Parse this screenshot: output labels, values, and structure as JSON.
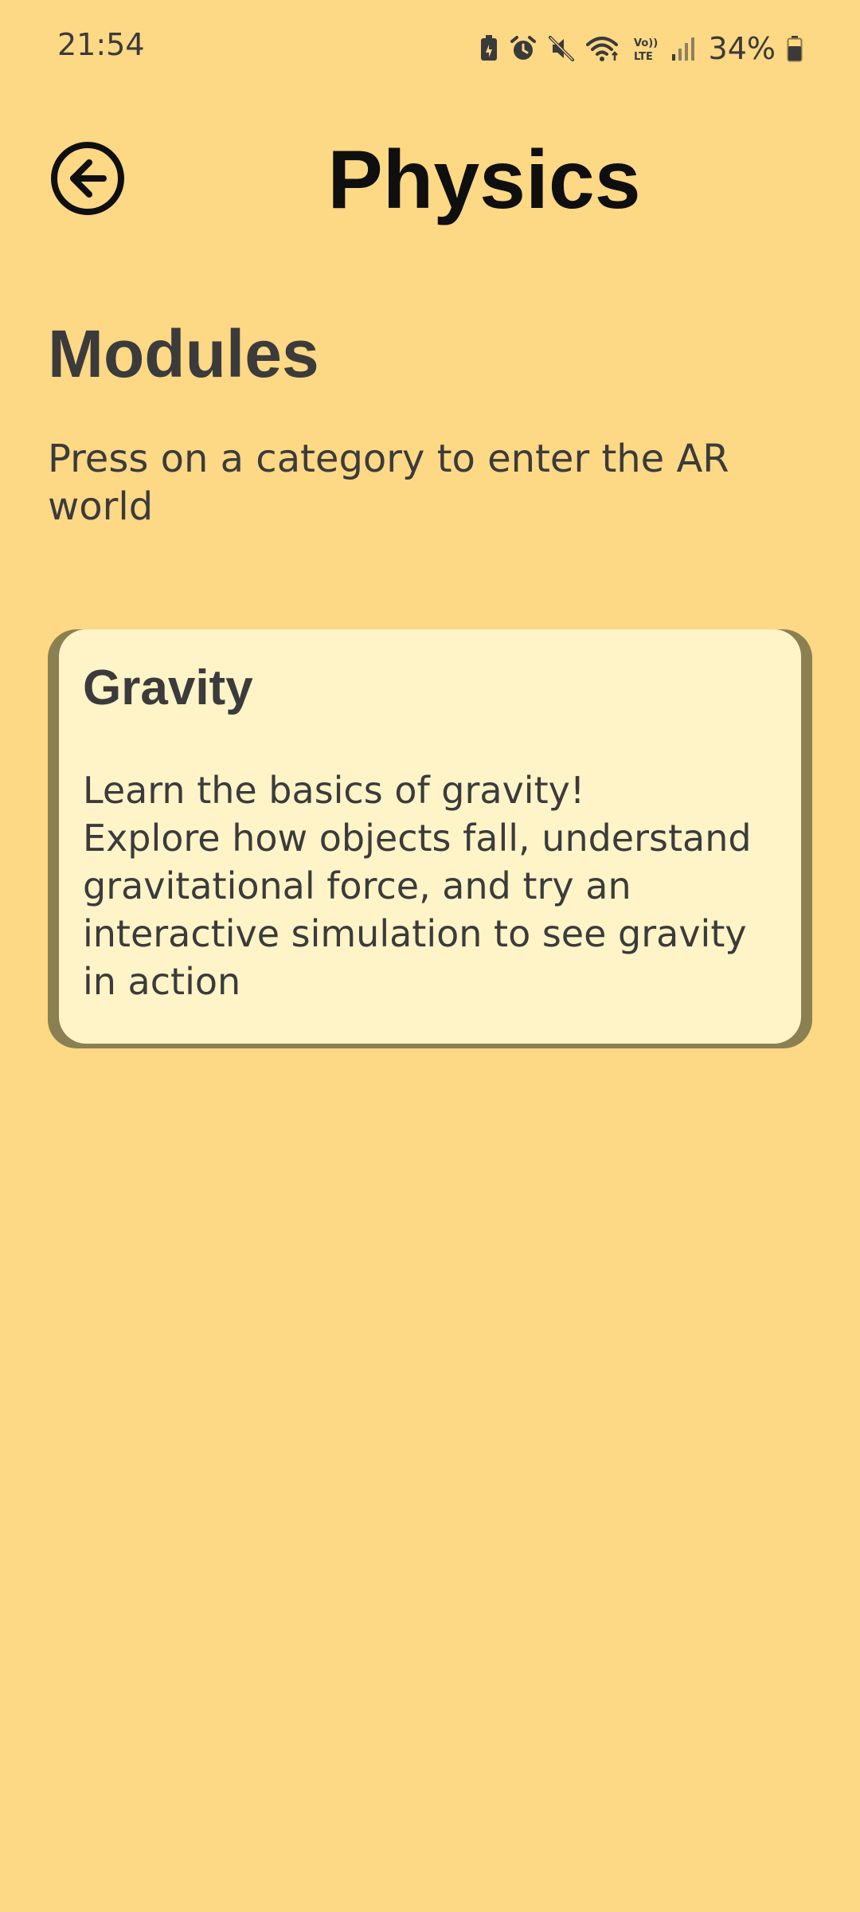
{
  "status_bar": {
    "time": "21:54",
    "battery_percent": "34%",
    "icons": [
      "battery-saver-icon",
      "alarm-icon",
      "mute-icon",
      "wifi-icon",
      "volte-icon",
      "signal-icon",
      "battery-icon"
    ]
  },
  "header": {
    "title": "Physics",
    "back_icon": "back-arrow-circle-icon"
  },
  "section": {
    "title": "Modules",
    "subtitle": "Press on a category to enter the AR world"
  },
  "modules": [
    {
      "title": "Gravity",
      "description": "Learn the basics of gravity!\nExplore how objects fall, understand gravitational force, and try an interactive simulation to see gravity in action"
    }
  ],
  "colors": {
    "background": "#FDD885",
    "card": "#FFF4C8",
    "card_shadow": "#8A8052",
    "text": "#3B3B3B",
    "title": "#0F0F0F"
  }
}
